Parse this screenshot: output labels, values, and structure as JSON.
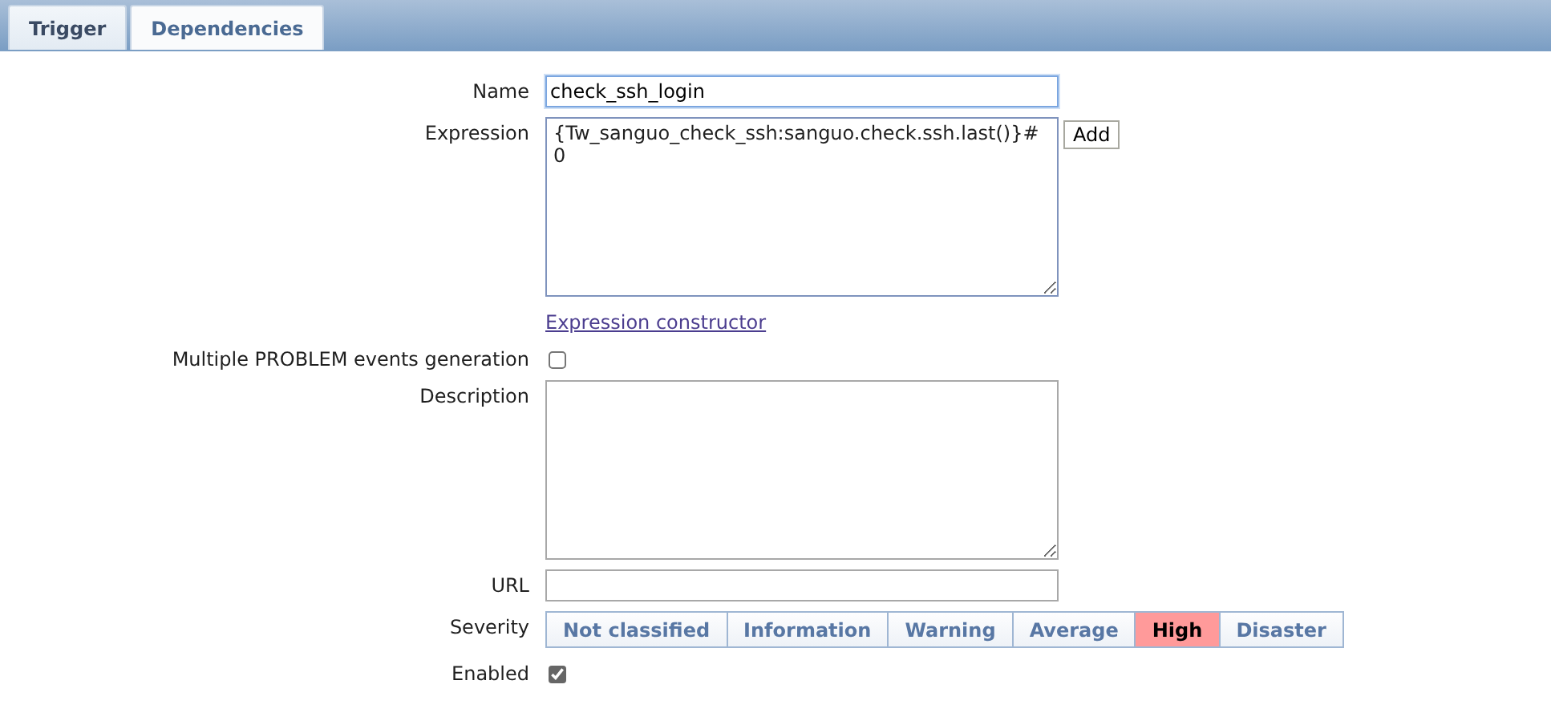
{
  "tabs": [
    {
      "label": "Trigger",
      "selected": true
    },
    {
      "label": "Dependencies",
      "selected": false
    }
  ],
  "form": {
    "name": {
      "label": "Name",
      "value": "check_ssh_login"
    },
    "expression": {
      "label": "Expression",
      "value": "{Tw_sanguo_check_ssh:sanguo.check.ssh.last()}#0",
      "button": "Add",
      "link": "Expression constructor"
    },
    "multiple_events": {
      "label": "Multiple PROBLEM events generation",
      "checked": false
    },
    "description": {
      "label": "Description"
    },
    "url": {
      "label": "URL"
    },
    "severity": {
      "label": "Severity",
      "options": [
        {
          "label": "Not classified",
          "selected": false
        },
        {
          "label": "Information",
          "selected": false
        },
        {
          "label": "Warning",
          "selected": false
        },
        {
          "label": "Average",
          "selected": false
        },
        {
          "label": "High",
          "selected": true
        },
        {
          "label": "Disaster",
          "selected": false
        }
      ]
    },
    "enabled": {
      "label": "Enabled",
      "checked": true
    }
  }
}
